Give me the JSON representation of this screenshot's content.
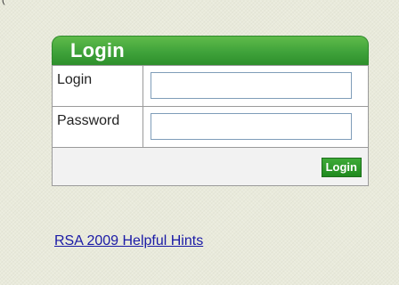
{
  "corner_mark": "(",
  "login_panel": {
    "title": "Login",
    "fields": [
      {
        "label": "Login",
        "value": "",
        "type": "text"
      },
      {
        "label": "Password",
        "value": "",
        "type": "password"
      }
    ],
    "submit_label": "Login"
  },
  "hints_link": {
    "text": "RSA 2009 Helpful Hints"
  },
  "colors": {
    "header_green": "#3fa23a",
    "button_green": "#2b952a",
    "link_blue": "#1a1aa6",
    "background": "#e9eadb"
  }
}
